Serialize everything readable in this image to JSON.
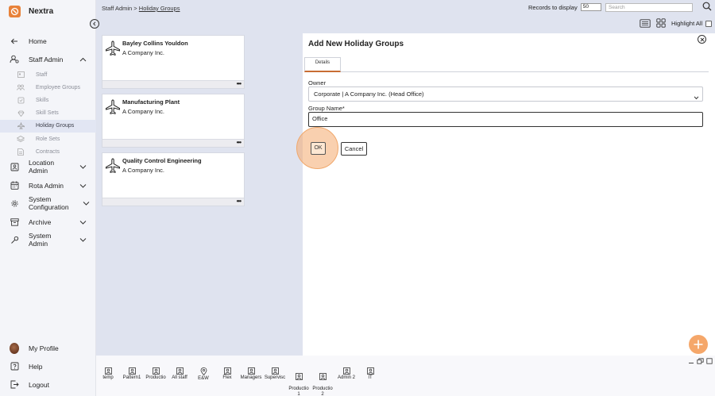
{
  "app": {
    "name": "Nextra"
  },
  "colors": {
    "accent": "#e8823a",
    "selected_bg": "#e2e6f3",
    "fab": "#f5a76a"
  },
  "sidebar": {
    "home": "Home",
    "staff_admin": {
      "label": "Staff Admin",
      "items": [
        "Staff",
        "Employee Groups",
        "Skills",
        "Skill Sets",
        "Holiday Groups",
        "Role Sets",
        "Contracts"
      ],
      "active_item": "Holiday Groups"
    },
    "location_admin": [
      "Location",
      "Admin"
    ],
    "rota_admin": "Rota Admin",
    "system_configuration": [
      "System",
      "Configuration"
    ],
    "archive": "Archive",
    "system_admin": [
      "System",
      "Admin"
    ],
    "bottom": {
      "my_profile": "My Profile",
      "help": "Help",
      "logout": "Logout"
    }
  },
  "header": {
    "breadcrumb_root": "Staff Admin",
    "breadcrumb_sep": " > ",
    "breadcrumb_current": "Holiday Groups",
    "records_label": "Records to display",
    "records_value": "50",
    "search_placeholder": "Search",
    "highlight_all": "Highlight All"
  },
  "cards": [
    {
      "title": "Bayley Collins Youldon",
      "company": "A Company Inc.",
      "more": "•••"
    },
    {
      "title": "Manufacturing Plant",
      "company": "A Company Inc.",
      "more": "•••"
    },
    {
      "title": "Quality Control Engineering",
      "company": "A Company Inc.",
      "more": "•••"
    }
  ],
  "panel": {
    "title": "Add New Holiday Groups",
    "tab_details": "Details",
    "owner_label": "Owner",
    "owner_value": "Corporate | A Company Inc. (Head Office)",
    "group_name_label": "Group Name*",
    "group_name_value": "Office",
    "ok": "OK",
    "cancel": "Cancel"
  },
  "toolbar": [
    {
      "label": "temp",
      "icon": "person-icon"
    },
    {
      "label": "Pattern1",
      "icon": "person-icon"
    },
    {
      "label": "Productio",
      "icon": "person-icon"
    },
    {
      "label": "All staff",
      "icon": "person-icon"
    },
    {
      "label": "E&W",
      "icon": "location-pin-icon"
    },
    {
      "label": "Flex",
      "icon": "person-icon"
    },
    {
      "label": "Managers",
      "icon": "person-icon"
    },
    {
      "label": "Supervisc",
      "icon": "person-icon"
    },
    {
      "label": "Productio\n1",
      "icon": "person-icon"
    },
    {
      "label": "Productio\n2",
      "icon": "person-icon"
    },
    {
      "label": "Admin 2",
      "icon": "person-icon"
    },
    {
      "label": "IT",
      "icon": "person-icon"
    }
  ]
}
